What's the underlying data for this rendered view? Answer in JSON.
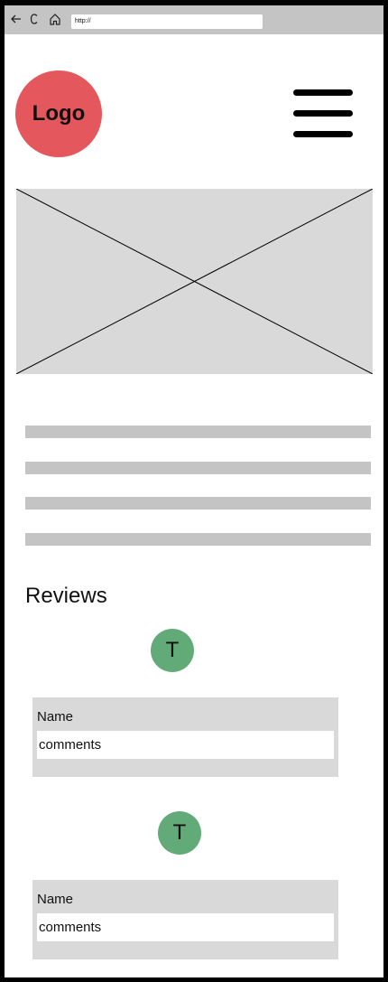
{
  "browser": {
    "url": "http://",
    "icons": [
      "back-arrow-icon",
      "refresh-icon",
      "home-icon"
    ]
  },
  "header": {
    "logo_text": "Logo",
    "menu_icon": "hamburger-menu-icon"
  },
  "hero": {
    "image_icon": "image-placeholder-icon"
  },
  "content": {
    "text_line_count": 4
  },
  "reviews": {
    "title": "Reviews",
    "items": [
      {
        "avatar_initial": "T",
        "name": "Name",
        "comment": "comments"
      },
      {
        "avatar_initial": "T",
        "name": "Name",
        "comment": "comments"
      }
    ]
  },
  "colors": {
    "logo": "#e4575c",
    "avatar": "#62ab79",
    "placeholder": "#d9d9d9",
    "browser_bar": "#c4c4c4"
  }
}
